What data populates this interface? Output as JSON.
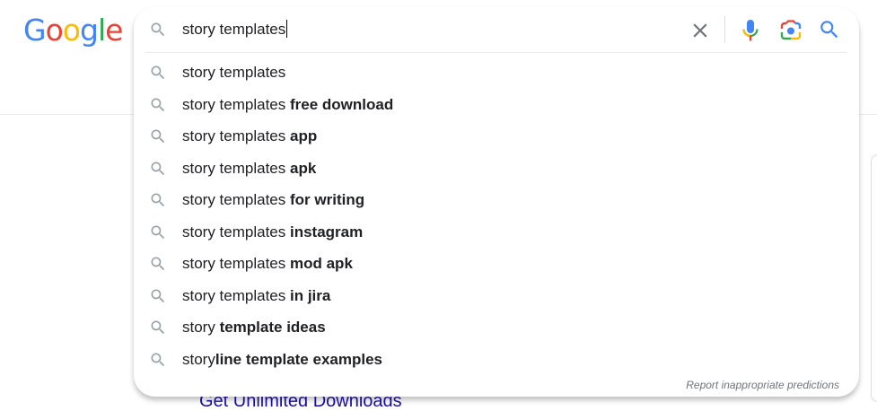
{
  "logo": {
    "letters": [
      "G",
      "o",
      "o",
      "g",
      "l",
      "e"
    ],
    "colors": [
      "#4285F4",
      "#EA4335",
      "#FBBC05",
      "#4285F4",
      "#34A853",
      "#EA4335"
    ]
  },
  "search": {
    "query": "story templates",
    "icons": {
      "leading": "search-icon",
      "clear": "close-icon",
      "voice": "microphone-icon",
      "image": "camera-lens-icon",
      "submit": "search-icon"
    }
  },
  "suggestions": [
    {
      "prefix": "story templates",
      "bold": ""
    },
    {
      "prefix": "story templates ",
      "bold": "free download"
    },
    {
      "prefix": "story templates ",
      "bold": "app"
    },
    {
      "prefix": "story templates ",
      "bold": "apk"
    },
    {
      "prefix": "story templates ",
      "bold": "for writing"
    },
    {
      "prefix": "story templates ",
      "bold": "instagram"
    },
    {
      "prefix": "story templates ",
      "bold": "mod apk"
    },
    {
      "prefix": "story templates ",
      "bold": "in jira"
    },
    {
      "prefix": "story ",
      "bold": "template ideas"
    },
    {
      "prefix": "story",
      "bold": "line template examples"
    }
  ],
  "report_link": "Report inappropriate predictions",
  "behind_link_text": "Get Unlimited Downloads",
  "colors": {
    "mic_blue": "#4285F4",
    "mic_red": "#EA4335",
    "mic_yellow": "#FBBC05",
    "mic_green": "#34A853",
    "search_blue": "#4285F4",
    "icon_gray": "#9aa0a6"
  }
}
